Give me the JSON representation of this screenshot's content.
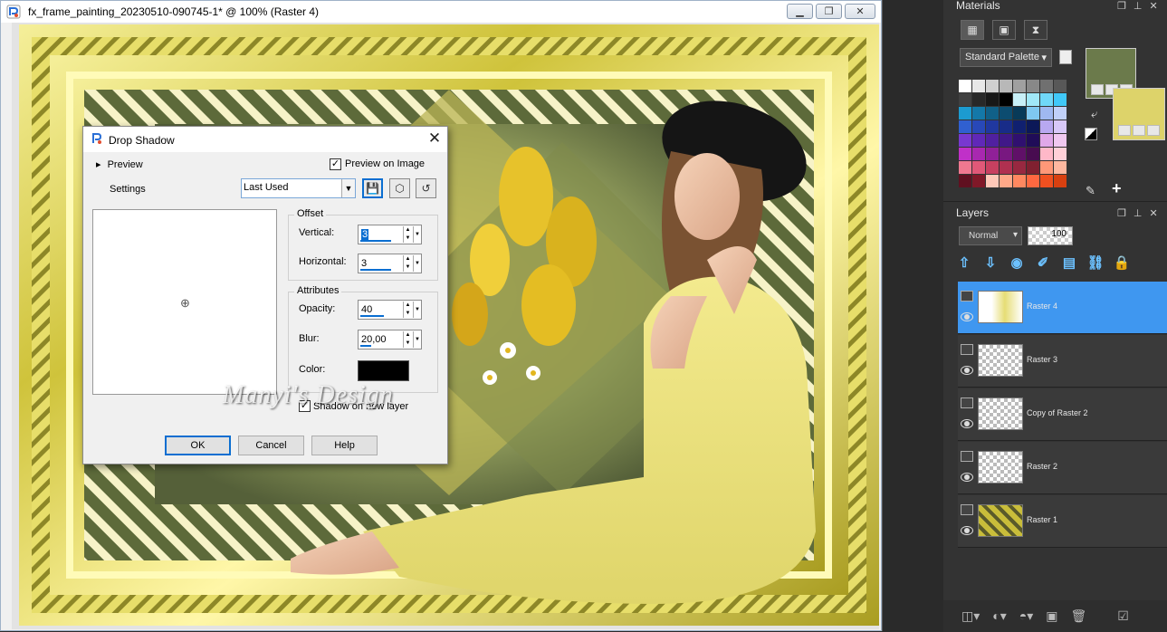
{
  "window": {
    "title": "fx_frame_painting_20230510-090745-1* @ 100% (Raster 4)",
    "minimize": "▁",
    "restore": "❐",
    "close": "✕"
  },
  "watermark": "Manyi's Design",
  "dialog": {
    "title": "Drop Shadow",
    "preview_toggle": "Preview",
    "preview_on_image": "Preview on Image",
    "settings_label": "Settings",
    "preset": "Last Used",
    "offset_group": "Offset",
    "vertical_label": "Vertical:",
    "vertical_value": "3",
    "horizontal_label": "Horizontal:",
    "horizontal_value": "3",
    "attributes_group": "Attributes",
    "opacity_label": "Opacity:",
    "opacity_value": "40",
    "blur_label": "Blur:",
    "blur_value": "20,00",
    "color_label": "Color:",
    "shadow_color": "#000000",
    "shadow_new_layer": "Shadow on new layer",
    "ok": "OK",
    "cancel": "Cancel",
    "help": "Help"
  },
  "materials": {
    "title": "Materials",
    "palette": "Standard Palette",
    "foreground_color": "#6b7a4b",
    "background_color": "#ddd36a",
    "swatches": [
      "#ffffff",
      "#e8e8e8",
      "#d0d0d0",
      "#b8b8b8",
      "#a0a0a0",
      "#888888",
      "#707070",
      "#585858",
      "#404040",
      "#282828",
      "#181818",
      "#000000",
      "#c8f0f8",
      "#a0e8f8",
      "#70d8f8",
      "#40c8f8",
      "#1c9bd0",
      "#1478a8",
      "#106088",
      "#0c4c70",
      "#083a58",
      "#7fc8f0",
      "#9fb8f0",
      "#c0d0f8",
      "#3060d0",
      "#2848b8",
      "#2038a0",
      "#182c88",
      "#102070",
      "#0c1858",
      "#b8a8f0",
      "#d8c8f8",
      "#7838d0",
      "#6028b8",
      "#5020a0",
      "#401888",
      "#301070",
      "#200c58",
      "#e0a8e8",
      "#f0c8f0",
      "#c030c8",
      "#a828b0",
      "#902098",
      "#781880",
      "#601068",
      "#480c50",
      "#ffb8c8",
      "#ffd0d8",
      "#f07890",
      "#e05878",
      "#c84060",
      "#b03050",
      "#982840",
      "#802030",
      "#ff9878",
      "#ffb8a0",
      "#601020",
      "#801828",
      "#ffc8b8",
      "#ffa888",
      "#ff8860",
      "#ff6840",
      "#f05020",
      "#d84010"
    ]
  },
  "layers": {
    "title": "Layers",
    "blend_mode": "Normal",
    "opacity": "100",
    "items": [
      {
        "name": "Raster 4"
      },
      {
        "name": "Raster 3"
      },
      {
        "name": "Copy of Raster 2"
      },
      {
        "name": "Raster 2"
      },
      {
        "name": "Raster 1"
      }
    ]
  }
}
